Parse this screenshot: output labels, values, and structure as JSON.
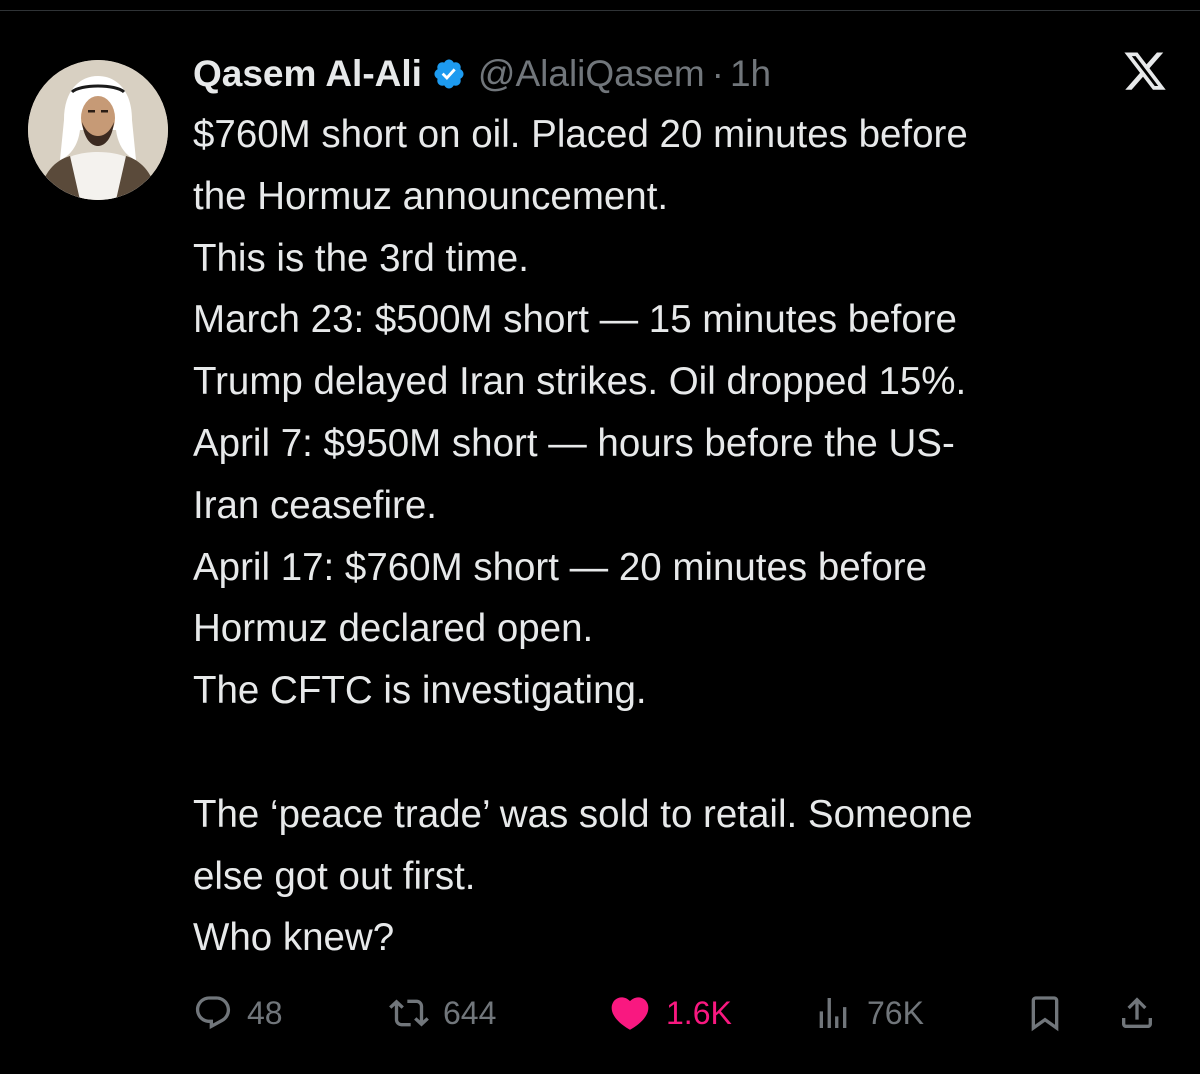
{
  "tweet": {
    "author": {
      "display_name": "Qasem Al-Ali",
      "handle": "@AlaliQasem",
      "separator": "·",
      "time": "1h",
      "verified": true,
      "avatar_icon": "avatar-photo"
    },
    "platform_icon": "x-logo-icon",
    "body_lines": [
      "$760M short on oil. Placed 20 minutes before",
      "the Hormuz announcement.",
      "This is the 3rd time.",
      "March 23: $500M short — 15 minutes before",
      "Trump delayed Iran strikes. Oil dropped 15%.",
      "April 7: $950M short — hours before the US-",
      "Iran ceasefire.",
      "April 17: $760M short — 20 minutes before",
      "Hormuz declared open.",
      "The CFTC is investigating.",
      "",
      "The ‘peace trade’ was sold to retail. Someone",
      "else got out first.",
      "Who knew?"
    ],
    "actions": {
      "replies": {
        "icon": "reply-icon",
        "count": "48"
      },
      "retweets": {
        "icon": "retweet-icon",
        "count": "644"
      },
      "likes": {
        "icon": "heart-icon",
        "count": "1.6K",
        "active": true
      },
      "views": {
        "icon": "views-icon",
        "count": "76K"
      },
      "bookmark": {
        "icon": "bookmark-icon"
      },
      "share": {
        "icon": "share-icon"
      }
    }
  },
  "colors": {
    "background": "#000000",
    "text_primary": "#e7e9ea",
    "text_secondary": "#71767b",
    "verified_blue": "#1d9bf0",
    "like_pink": "#f91880"
  }
}
